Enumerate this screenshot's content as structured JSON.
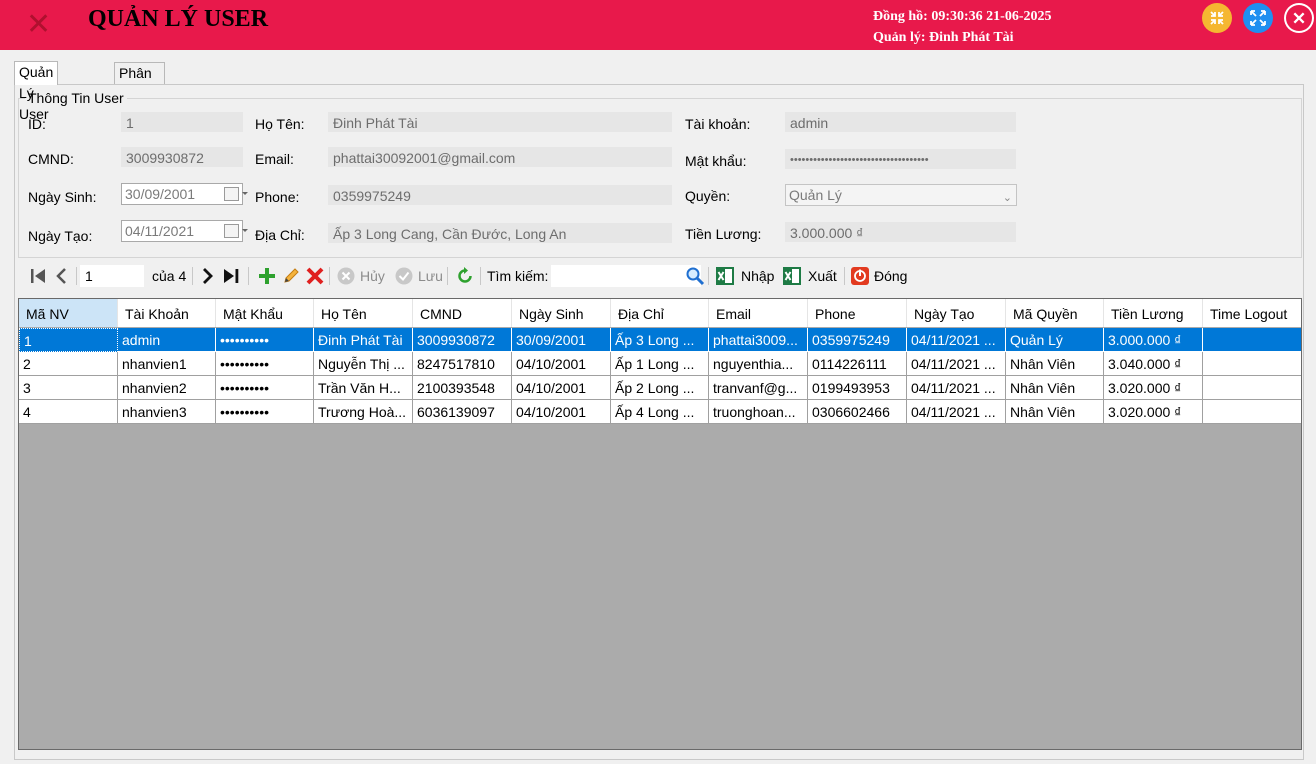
{
  "window": {
    "title": "QUẢN LÝ USER",
    "clock": "Đồng hồ: 09:30:36 21-06-2025",
    "manager": "Quản lý: Đinh Phát Tài",
    "colors": {
      "titlebar": "#e8194b",
      "minimize": "#f5b731",
      "restore": "#1f8ff0",
      "close": "#e8194b"
    }
  },
  "tabs": [
    {
      "label": "Quản Lý User",
      "active": true
    },
    {
      "label": "Phân Quyền",
      "active": false
    }
  ],
  "form": {
    "group_title": "Thông Tin User",
    "id": {
      "label": "ID:",
      "value": "1"
    },
    "fullname": {
      "label": "Họ Tên:",
      "value": "Đinh Phát Tài"
    },
    "account": {
      "label": "Tài khoản:",
      "value": "admin"
    },
    "cmnd": {
      "label": "CMND:",
      "value": "3009930872"
    },
    "email": {
      "label": "Email:",
      "value": "phattai30092001@gmail.com"
    },
    "password": {
      "label": "Mật khẩu:",
      "value": "••••••••••••••••••••••••••••••••••••"
    },
    "dob": {
      "label": "Ngày Sinh:",
      "value": "30/09/2001"
    },
    "phone": {
      "label": "Phone:",
      "value": "0359975249"
    },
    "role": {
      "label": "Quyền:",
      "value": "Quản Lý"
    },
    "created": {
      "label": "Ngày Tạo:",
      "value": "04/11/2021"
    },
    "address": {
      "label": "Địa Chỉ:",
      "value": "Ấp 3 Long Cang, Cần Đước, Long An"
    },
    "salary": {
      "label": "Tiền Lương:",
      "value": "3.000.000 ₫"
    }
  },
  "toolbar": {
    "page_value": "1",
    "page_of": "của 4",
    "cancel_label": "Hủy",
    "save_label": "Lưu",
    "search_label": "Tìm kiếm:",
    "search_value": "",
    "import_label": "Nhập",
    "export_label": "Xuất",
    "close_label": "Đóng"
  },
  "grid": {
    "columns": [
      "Mã NV",
      "Tài Khoản",
      "Mật Khẩu",
      "Họ Tên",
      "CMND",
      "Ngày Sinh",
      "Địa Chỉ",
      "Email",
      "Phone",
      "Ngày Tạo",
      "Mã Quyền",
      "Tiền Lương",
      "Time Logout"
    ],
    "rows": [
      [
        "1",
        "admin",
        "••••••••••",
        "Đinh Phát Tài",
        "3009930872",
        "30/09/2001",
        "Ấp 3 Long ...",
        "phattai3009...",
        "0359975249",
        "04/11/2021 ...",
        "Quản Lý",
        "3.000.000 ₫",
        ""
      ],
      [
        "2",
        "nhanvien1",
        "••••••••••",
        "Nguyễn Thị ...",
        "8247517810",
        "04/10/2001",
        "Ấp 1 Long ...",
        "nguyenthia...",
        "0114226111",
        "04/11/2021 ...",
        "Nhân Viên",
        "3.040.000 ₫",
        ""
      ],
      [
        "3",
        "nhanvien2",
        "••••••••••",
        "Trần Văn H...",
        "2100393548",
        "04/10/2001",
        "Ấp 2 Long ...",
        "tranvanf@g...",
        "0199493953",
        "04/11/2021 ...",
        "Nhân Viên",
        "3.020.000 ₫",
        ""
      ],
      [
        "4",
        "nhanvien3",
        "••••••••••",
        "Trương Hoà...",
        "6036139097",
        "04/10/2001",
        "Ấp 4 Long ...",
        "truonghoan...",
        "0306602466",
        "04/11/2021 ...",
        "Nhân Viên",
        "3.020.000 ₫",
        ""
      ]
    ],
    "selected_row": 0
  }
}
